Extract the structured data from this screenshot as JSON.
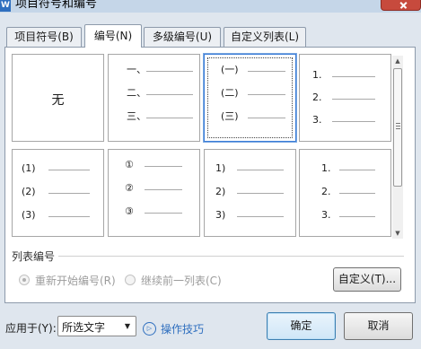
{
  "window": {
    "title": "项目符号和编号",
    "app_icon": "W",
    "close_icon": "close-icon"
  },
  "tabs": [
    {
      "label": "项目符号(B)",
      "active": false
    },
    {
      "label": "编号(N)",
      "active": true
    },
    {
      "label": "多级编号(U)",
      "active": false
    },
    {
      "label": "自定义列表(L)",
      "active": false
    }
  ],
  "presets": [
    {
      "id": "none",
      "label": "无",
      "markers": []
    },
    {
      "id": "chinese-comma",
      "markers": [
        "一、",
        "二、",
        "三、"
      ]
    },
    {
      "id": "chinese-paren",
      "markers": [
        "(一)",
        "(二)",
        "(三)"
      ],
      "selected": true
    },
    {
      "id": "arabic-dot",
      "markers": [
        "1.",
        "2.",
        "3."
      ]
    },
    {
      "id": "arabic-paren",
      "markers": [
        "(1)",
        "(2)",
        "(3)"
      ]
    },
    {
      "id": "circled",
      "markers": [
        "①",
        "②",
        "③"
      ]
    },
    {
      "id": "arabic-half-paren",
      "markers": [
        "1)",
        "2)",
        "3)"
      ]
    },
    {
      "id": "arabic-dot-indented",
      "markers": [
        "1.",
        "2.",
        "3."
      ]
    }
  ],
  "scrollbar": {
    "up_arrow": "▲",
    "down_arrow": "▼"
  },
  "list_numbering": {
    "label": "列表编号",
    "restart_label": "重新开始编号(R)",
    "continue_label": "继续前一列表(C)",
    "restart_checked": true,
    "custom_button": "自定义(T)..."
  },
  "footer": {
    "apply_label": "应用于(Y):",
    "apply_value": "所选文字",
    "dropdown_arrow": "▼",
    "tips_icon": "▷",
    "tips_label": "操作技巧",
    "ok_button": "确定",
    "cancel_button": "取消"
  },
  "colors": {
    "selection": "#3b7dd8",
    "link": "#2f6fbf",
    "close": "#c74a3d",
    "dialog_bg": "#dfe6ee"
  }
}
